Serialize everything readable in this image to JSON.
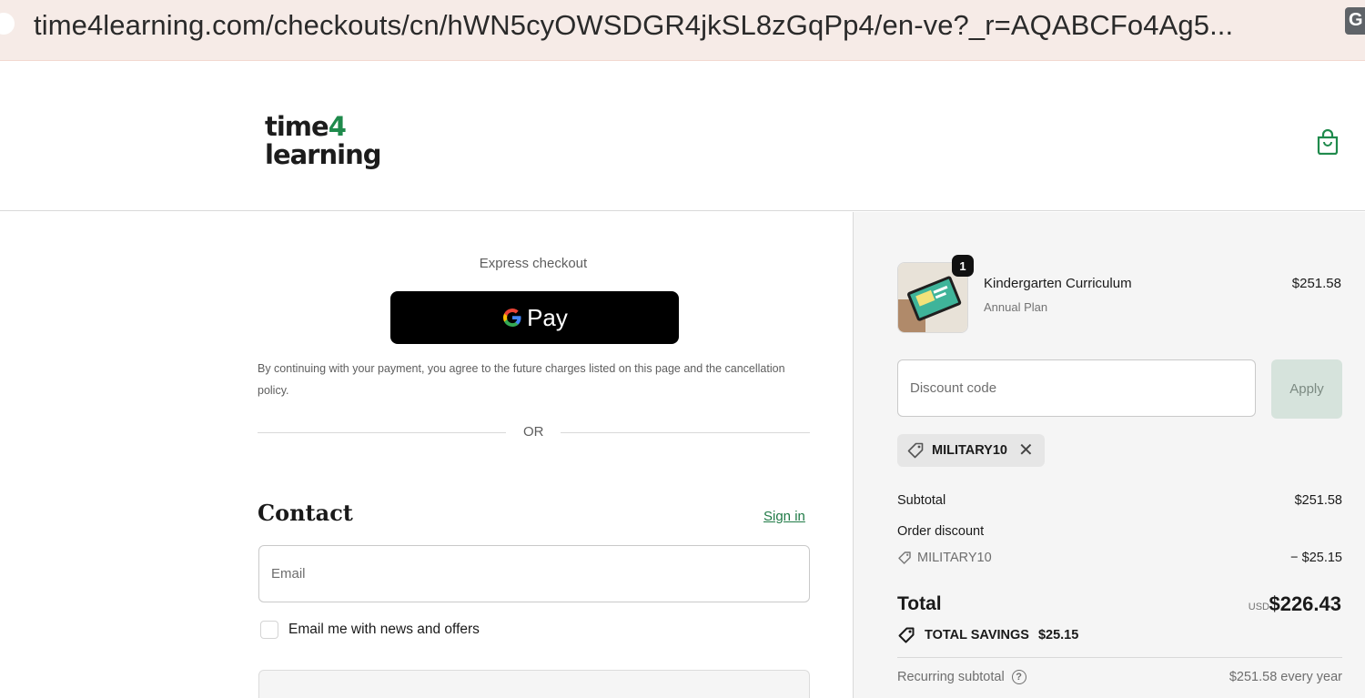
{
  "browser": {
    "url": "time4learning.com/checkouts/cn/hWN5cyOWSDGR4jkSL8zGqPp4/en-ve?_r=AQABCFo4Ag5...",
    "extension_icon": "G"
  },
  "header": {
    "logo": {
      "line1_prefix": "time",
      "line1_accent": "4",
      "line2": "learning"
    },
    "cart_icon": "shopping-bag-icon"
  },
  "checkout": {
    "express_label": "Express checkout",
    "gpay_label": "Pay",
    "consent_text": "By continuing with your payment, you agree to the future charges listed on this page and the cancellation policy.",
    "or_label": "OR",
    "contact_title": "Contact",
    "signin_label": "Sign in",
    "email_placeholder": "Email",
    "newsletter_label": "Email me with news and offers"
  },
  "summary": {
    "item": {
      "quantity": "1",
      "name": "Kindergarten Curriculum",
      "plan": "Annual Plan",
      "price": "$251.58"
    },
    "discount_placeholder": "Discount code",
    "apply_label": "Apply",
    "applied_code": "MILITARY10",
    "subtotal_label": "Subtotal",
    "subtotal_value": "$251.58",
    "order_discount_label": "Order discount",
    "discount_code_label": "MILITARY10",
    "discount_value": "− $25.15",
    "total_label": "Total",
    "total_currency": "USD",
    "total_value": "$226.43",
    "savings_label": "TOTAL SAVINGS",
    "savings_value": "$25.15",
    "recurring_label": "Recurring subtotal",
    "recurring_value": "$251.58 every year"
  },
  "colors": {
    "brand_green": "#1f8a4c",
    "apply_bg": "#d6e3dc",
    "summary_bg": "#f5f5f5"
  }
}
